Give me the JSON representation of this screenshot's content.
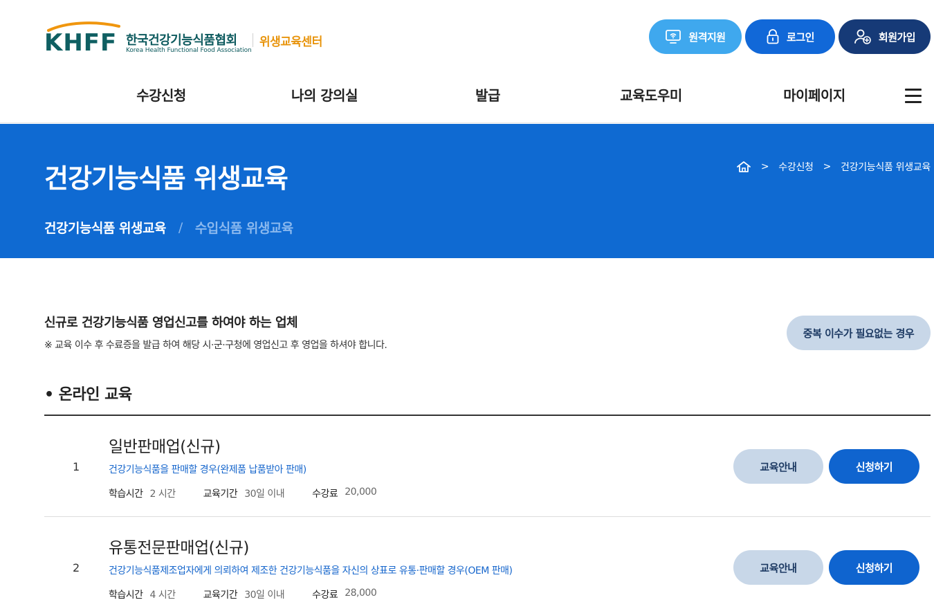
{
  "header": {
    "logo": {
      "mark": "KHFF",
      "org_name_kr": "한국건강기능식품협회",
      "org_name_en": "Korea Health Functional Food Association",
      "center_name": "위생교육센터"
    },
    "buttons": {
      "remote": "원격지원",
      "login": "로그인",
      "join": "회원가입"
    },
    "nav": [
      "수강신청",
      "나의 강의실",
      "발급",
      "교육도우미",
      "마이페이지"
    ]
  },
  "banner": {
    "title": "건강기능식품 위생교육",
    "breadcrumb": [
      "수강신청",
      "건강기능식품 위생교육"
    ],
    "tabs": {
      "active": "건강기능식품 위생교육",
      "separator": "/",
      "inactive": "수입식품 위생교육"
    }
  },
  "intro": {
    "title": "신규로 건강기능식품 영업신고를 하여야 하는 업체",
    "note": "※ 교육 이수 후 수료증을 발급 하여 해당 시·군·구청에 영업신고 후 영업을 하셔야 합니다.",
    "dup_button": "중복 이수가 필요없는 경우"
  },
  "section": {
    "title": "• 온라인 교육"
  },
  "labels": {
    "study_time": "학습시간",
    "period": "교육기간",
    "fee": "수강료",
    "guide_button": "교육안내",
    "apply_button": "신청하기"
  },
  "courses": [
    {
      "num": "1",
      "name": "일반판매업(신규)",
      "desc": "건강기능식품을 판매할 경우(완제품 납품받아 판매)",
      "study_time": "2 시간",
      "period": "30일 이내",
      "fee": "20,000"
    },
    {
      "num": "2",
      "name": "유통전문판매업(신규)",
      "desc": "건강기능식품제조업자에게 의뢰하여 제조한 건강기능식품을 자신의 상표로 유통·판매할 경우(OEM 판매)",
      "study_time": "4 시간",
      "period": "30일 이내",
      "fee": "28,000"
    }
  ],
  "colors": {
    "primary": "#0f6ad2",
    "navy": "#163a77",
    "sky": "#3fa8ee",
    "logo_teal": "#0f5f62",
    "logo_orange": "#e8940c",
    "soft_button": "#c8d7e8"
  }
}
